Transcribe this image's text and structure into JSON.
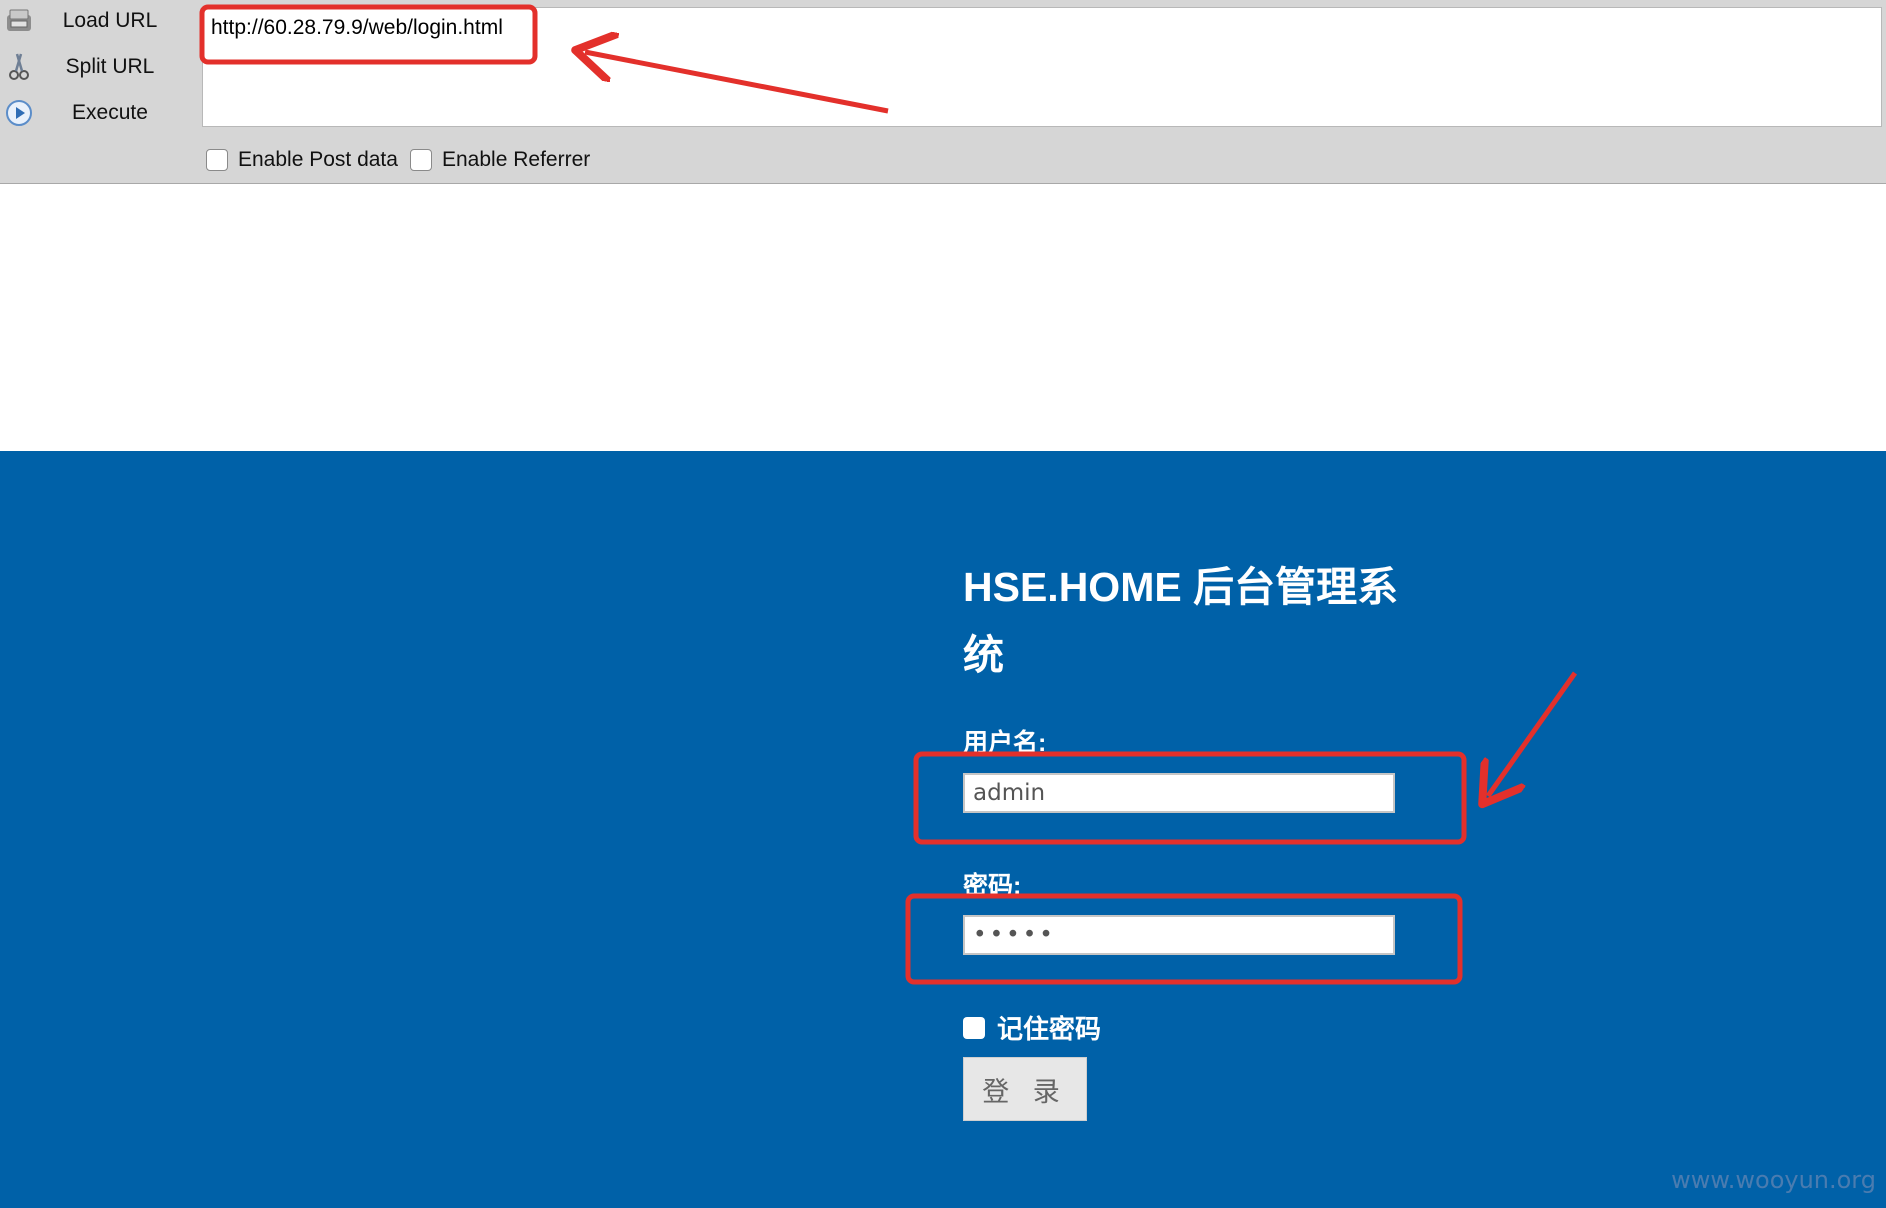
{
  "hackbar": {
    "commands": [
      {
        "label": "Load URL",
        "icon": "load-url-icon"
      },
      {
        "label": "Split URL",
        "icon": "scissors-icon"
      },
      {
        "label": "Execute",
        "icon": "play-icon"
      }
    ],
    "url": "http://60.28.79.9/web/login.html",
    "checkboxes": [
      {
        "label": "Enable Post data",
        "checked": false
      },
      {
        "label": "Enable Referrer",
        "checked": false
      }
    ]
  },
  "login": {
    "title": "HSE.HOME 后台管理系统",
    "username_label": "用户名:",
    "username_value": "admin",
    "password_label": "密码:",
    "password_value": "•••••",
    "remember_label": "记住密码",
    "remember_checked": false,
    "submit_label": "登 录"
  },
  "watermark": "www.wooyun.org",
  "colors": {
    "page_bg": "#0061a8",
    "toolbar_bg": "#d6d6d6",
    "annotation_red": "#e3302b"
  }
}
